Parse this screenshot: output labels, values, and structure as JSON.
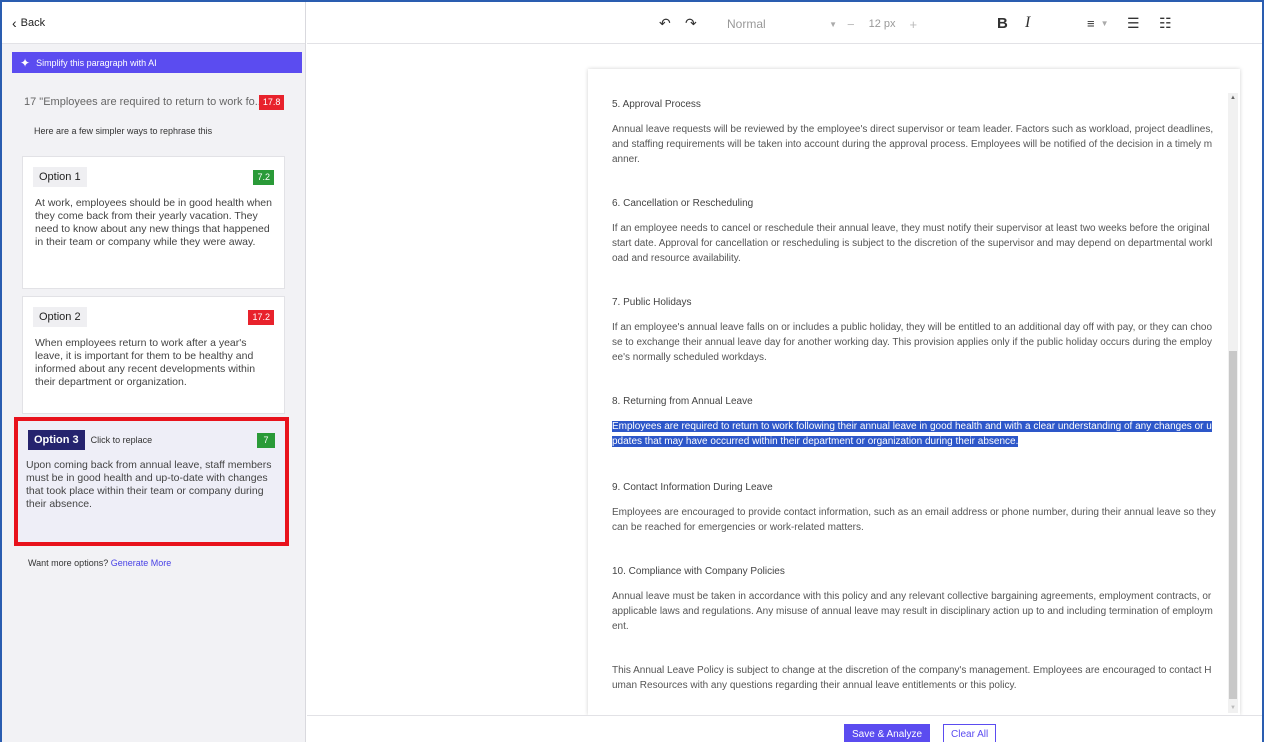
{
  "sidebar": {
    "back_label": "Back",
    "ai_bar_label": "Simplify this paragraph with AI",
    "original": {
      "text": "17 \"Employees are required to return to work fo...",
      "score": "17.8"
    },
    "subheading": "Here are a few simpler ways to rephrase this",
    "options": [
      {
        "label": "Option 1",
        "score": "7.2",
        "text": "At work, employees should be in good health when they come back from their yearly vacation. They need to know about any new things that happened in their team or company while they were away."
      },
      {
        "label": "Option 2",
        "score": "17.2",
        "text": "When employees return to work after a year's leave, it is important for them to be healthy and informed about any recent developments within their department or organization."
      },
      {
        "label": "Option 3",
        "hint": "Click to replace",
        "score": "7",
        "text": "Upon coming back from annual leave, staff members must be in good health and up-to-date with changes that took place within their team or company during their absence."
      }
    ],
    "more_prefix": "Want more options?",
    "more_link": "Generate More"
  },
  "toolbar": {
    "style_value": "Normal",
    "size_value": "12",
    "size_unit": "px",
    "bold": "B",
    "italic": "I"
  },
  "document": {
    "sections": [
      {
        "title": "5. Approval Process",
        "body": "Annual leave requests will be reviewed by the employee's direct supervisor or team leader. Factors such as workload, project deadlines, and staffing requirements will be taken into account during the approval process. Employees will be notified of the decision in a timely manner."
      },
      {
        "title": "6. Cancellation or Rescheduling",
        "body": "If an employee needs to cancel or reschedule their annual leave, they must notify their supervisor at least two weeks before the original start date. Approval for cancellation or rescheduling is subject to the discretion of the supervisor and may depend on departmental workload and resource availability."
      },
      {
        "title": "7. Public Holidays",
        "body": "If an employee's annual leave falls on or includes a public holiday, they will be entitled to an additional day off with pay, or they can choose to exchange their annual leave day for another working day. This provision applies only if the public holiday occurs during the employee's normally scheduled workdays."
      },
      {
        "title": "8. Returning from Annual Leave",
        "body": "Employees are required to return to work following their annual leave in good health and with a clear understanding of any changes or updates that may have occurred within their department or organization during their absence."
      },
      {
        "title": "9. Contact Information During Leave",
        "body": "Employees are encouraged to provide contact information, such as an email address or phone number, during their annual leave so they can be reached for emergencies or work-related matters."
      },
      {
        "title": "10. Compliance with Company Policies",
        "body": "Annual leave must be taken in accordance with this policy and any relevant collective bargaining agreements, employment contracts, or applicable laws and regulations. Any misuse of annual leave may result in disciplinary action up to and including termination of employment."
      }
    ],
    "closing": "This Annual Leave Policy is subject to change at the discretion of the company's management. Employees are encouraged to contact Human Resources with any questions regarding their annual leave entitlements or this policy."
  },
  "footer": {
    "save_label": "Save & Analyze",
    "clear_label": "Clear All"
  },
  "colors": {
    "accent": "#5b4cf0",
    "selected_border": "#e8121c",
    "highlight": "#2d57c9",
    "badge_red": "#e8222c",
    "badge_green": "#2a9a38"
  }
}
